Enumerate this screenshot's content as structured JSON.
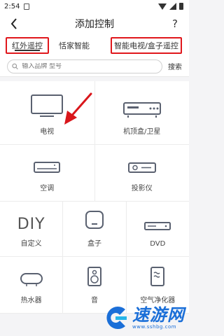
{
  "status_bar": {
    "time": "2:54"
  },
  "header": {
    "title": "添加控制",
    "help": "?"
  },
  "tabs": [
    {
      "label": "红外遥控",
      "active": true
    },
    {
      "label": "恬家智能",
      "active": false
    },
    {
      "label": "智能电视/盒子遥控",
      "active": false
    }
  ],
  "search": {
    "placeholder": "输入品牌 型号",
    "button": "搜索"
  },
  "devices": {
    "tv": "电视",
    "stb": "机顶盒/卫星",
    "ac": "空调",
    "projector": "投影仪",
    "diy_icon": "DIY",
    "diy": "自定义",
    "box": "盒子",
    "dvd": "DVD",
    "heater": "热水器",
    "speaker": "音",
    "purifier": "空气净化器"
  },
  "watermark": {
    "title": "速游网",
    "url": "www.sshbg.com"
  },
  "colors": {
    "highlight": "#e0171c",
    "arrow": "#d9161b",
    "watermark": "#1b6fd8"
  }
}
